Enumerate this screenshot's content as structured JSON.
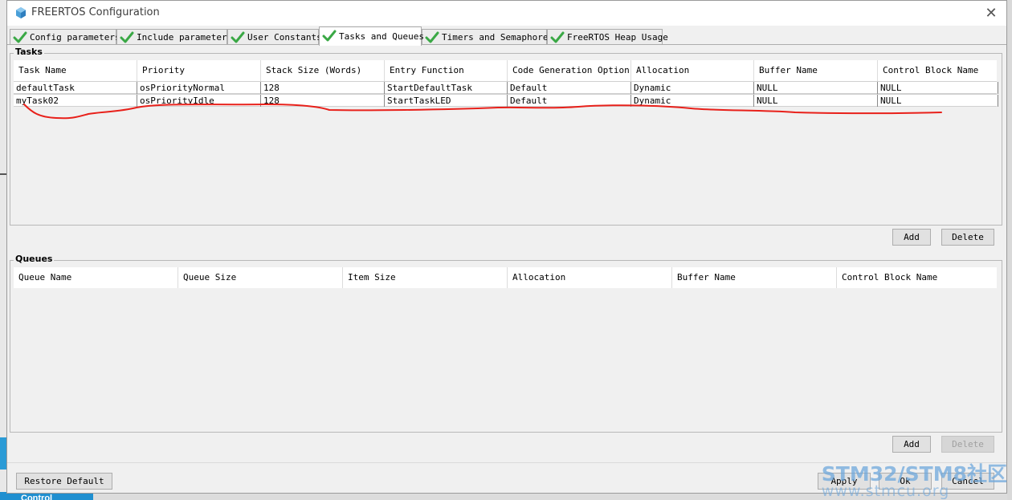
{
  "window": {
    "title": "FREERTOS Configuration",
    "close_glyph": "✕",
    "icon": "cube-icon"
  },
  "tabs": [
    {
      "label": "Config parameters",
      "status": "check-icon",
      "active": false
    },
    {
      "label": "Include parameters",
      "status": "check-icon",
      "active": false
    },
    {
      "label": "User Constants",
      "status": "check-icon",
      "active": false
    },
    {
      "label": "Tasks and Queues",
      "status": "check-icon",
      "active": true
    },
    {
      "label": "Timers and Semaphores",
      "status": "check-icon",
      "active": false
    },
    {
      "label": "FreeRTOS Heap Usage",
      "status": "check-icon",
      "active": false
    }
  ],
  "tasks": {
    "group_label": "Tasks",
    "columns": [
      "Task Name",
      "Priority",
      "Stack Size (Words)",
      "Entry Function",
      "Code Generation Option",
      "Allocation",
      "Buffer Name",
      "Control Block Name"
    ],
    "rows": [
      [
        "defaultTask",
        "osPriorityNormal",
        "128",
        "StartDefaultTask",
        "Default",
        "Dynamic",
        "NULL",
        "NULL"
      ],
      [
        "myTask02",
        "osPriorityIdle",
        "128",
        "StartTaskLED",
        "Default",
        "Dynamic",
        "NULL",
        "NULL"
      ]
    ],
    "add_label": "Add",
    "delete_label": "Delete"
  },
  "queues": {
    "group_label": "Queues",
    "columns": [
      "Queue Name",
      "Queue Size",
      "Item Size",
      "Allocation",
      "Buffer Name",
      "Control Block Name"
    ],
    "rows": [],
    "add_label": "Add",
    "delete_label": "Delete"
  },
  "footer": {
    "restore_label": "Restore Default",
    "apply_label": "Apply",
    "ok_label": "Ok",
    "cancel_label": "Cancel"
  },
  "background": {
    "peek_label": "Control"
  },
  "watermark": {
    "title": "STM32/STM8社区",
    "url": "www.stmcu.org"
  },
  "colors": {
    "check_green": "#3aa845",
    "annotation_red": "#e8201a",
    "watermark_blue": "#6fa8dc"
  }
}
